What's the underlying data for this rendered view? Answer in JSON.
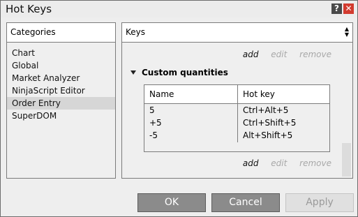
{
  "window": {
    "title": "Hot Keys",
    "help_label": "?",
    "close_label": "✕"
  },
  "categories": {
    "header": "Categories",
    "items": [
      {
        "label": "Chart"
      },
      {
        "label": "Global"
      },
      {
        "label": "Market Analyzer"
      },
      {
        "label": "NinjaScript Editor"
      },
      {
        "label": "Order Entry",
        "selected": true
      },
      {
        "label": "SuperDOM"
      }
    ]
  },
  "keys": {
    "header": "Keys",
    "top_actions": {
      "add": "add",
      "edit": "edit",
      "remove": "remove"
    },
    "group": "Custom quantities",
    "table": {
      "columns": [
        "Name",
        "Hot key"
      ],
      "rows": [
        {
          "name": "5",
          "hotkey": "Ctrl+Alt+5"
        },
        {
          "name": "+5",
          "hotkey": "Ctrl+Shift+5"
        },
        {
          "name": "-5",
          "hotkey": "Alt+Shift+5"
        }
      ]
    },
    "bottom_actions": {
      "add": "add",
      "edit": "edit",
      "remove": "remove"
    }
  },
  "buttons": {
    "ok": "OK",
    "cancel": "Cancel",
    "apply": "Apply"
  }
}
